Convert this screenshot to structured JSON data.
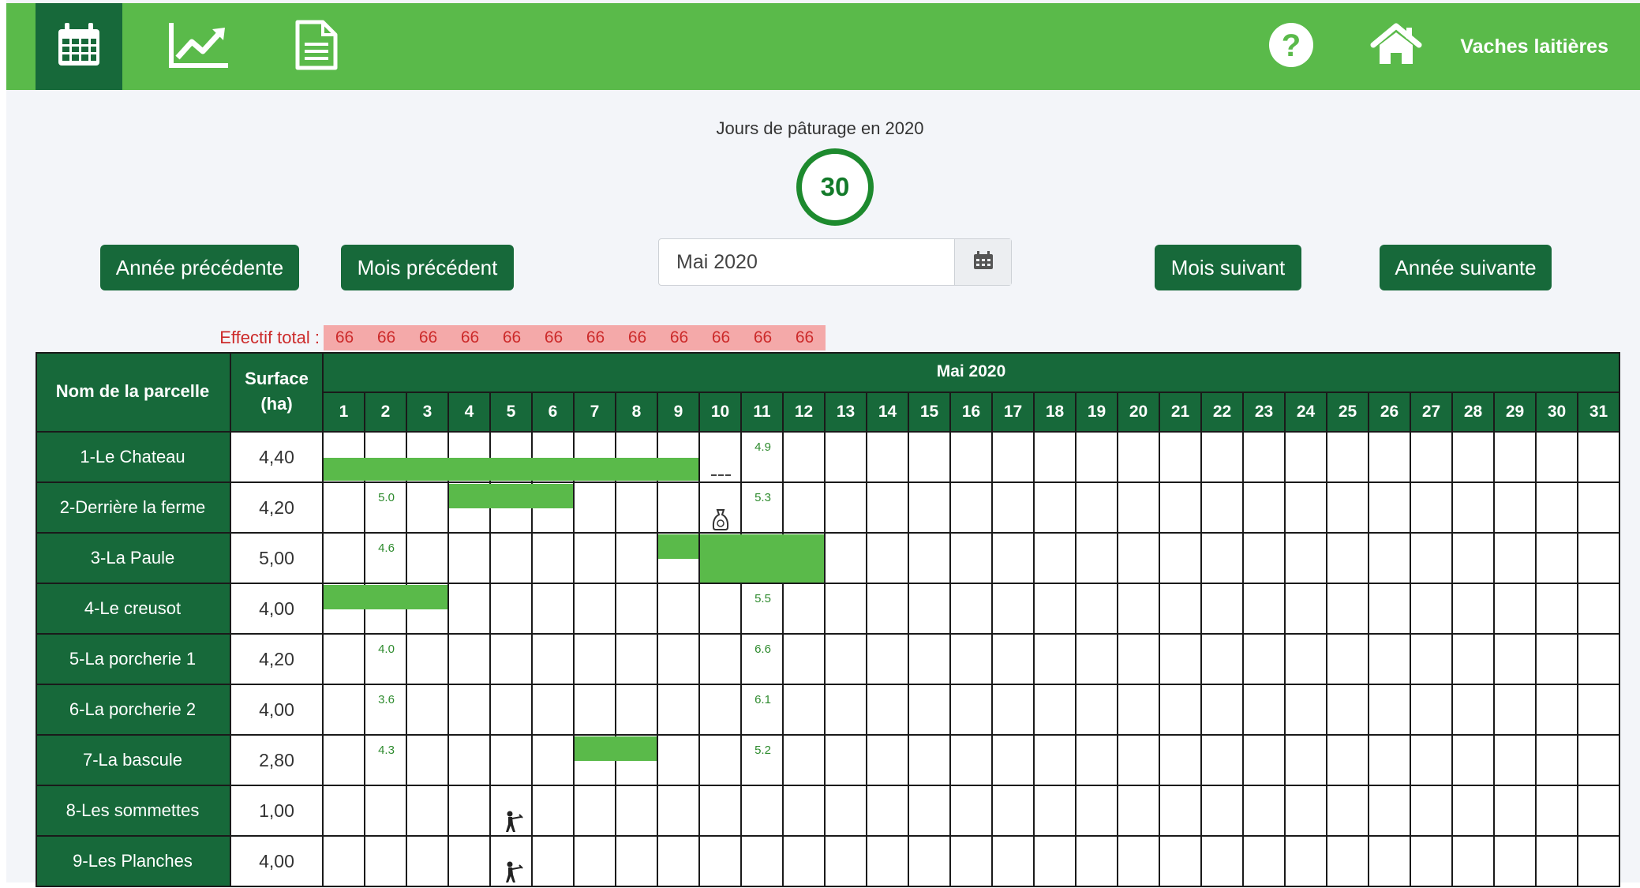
{
  "nav": {
    "tabs": [
      {
        "name": "calendar-icon",
        "active": true
      },
      {
        "name": "chart-icon",
        "active": false
      },
      {
        "name": "document-icon",
        "active": false
      }
    ],
    "help_icon": "question-circle-icon",
    "home_icon": "home-icon",
    "farm_label": "Vaches laitières"
  },
  "colors": {
    "nav_green": "#5aba4a",
    "dark_green": "#17693a",
    "grazing_bar": "#5aba4a",
    "effectif_bg": "#f4a9a9",
    "effectif_text": "#cc2a2a"
  },
  "summary": {
    "title": "Jours de pâturage en 2020",
    "days": "30"
  },
  "controls": {
    "prev_year": "Année précédente",
    "prev_month": "Mois précédent",
    "month_value": "Mai 2020",
    "next_month": "Mois suivant",
    "next_year": "Année suivante"
  },
  "effectif": {
    "label": "Effectif total :",
    "values": [
      "66",
      "66",
      "66",
      "66",
      "66",
      "66",
      "66",
      "66",
      "66",
      "66",
      "66",
      "66"
    ]
  },
  "table": {
    "col_name": "Nom de la parcelle",
    "col_surface": "Surface (ha)",
    "month_title": "Mai 2020",
    "days": [
      "1",
      "2",
      "3",
      "4",
      "5",
      "6",
      "7",
      "8",
      "9",
      "10",
      "11",
      "12",
      "13",
      "14",
      "15",
      "16",
      "17",
      "18",
      "19",
      "20",
      "21",
      "22",
      "23",
      "24",
      "25",
      "26",
      "27",
      "28",
      "29",
      "30",
      "31"
    ],
    "rows": [
      {
        "name": "1-Le Chateau",
        "surface": "4,40",
        "grazing": [
          {
            "from": 1,
            "to": 9,
            "band": "bottom"
          }
        ],
        "notes": [
          {
            "day": 11,
            "text": "4.9"
          }
        ],
        "icons": [
          {
            "day": 10,
            "type": "dash-icon"
          }
        ]
      },
      {
        "name": "2-Derrière la ferme",
        "surface": "4,20",
        "grazing": [
          {
            "from": 4,
            "to": 6,
            "band": "top"
          }
        ],
        "notes": [
          {
            "day": 2,
            "text": "5.0"
          },
          {
            "day": 11,
            "text": "5.3"
          }
        ],
        "icons": [
          {
            "day": 10,
            "type": "fertilizer-bag-icon"
          }
        ]
      },
      {
        "name": "3-La Paule",
        "surface": "5,00",
        "grazing": [
          {
            "from": 9,
            "to": 9,
            "band": "top"
          },
          {
            "from": 10,
            "to": 12,
            "band": "full"
          }
        ],
        "notes": [
          {
            "day": 2,
            "text": "4.6"
          }
        ],
        "icons": []
      },
      {
        "name": "4-Le creusot",
        "surface": "4,00",
        "grazing": [
          {
            "from": 1,
            "to": 3,
            "band": "top"
          }
        ],
        "notes": [
          {
            "day": 11,
            "text": "5.5"
          }
        ],
        "icons": []
      },
      {
        "name": "5-La porcherie 1",
        "surface": "4,20",
        "grazing": [],
        "notes": [
          {
            "day": 2,
            "text": "4.0"
          },
          {
            "day": 11,
            "text": "6.6"
          }
        ],
        "icons": []
      },
      {
        "name": "6-La porcherie 2",
        "surface": "4,00",
        "grazing": [],
        "notes": [
          {
            "day": 2,
            "text": "3.6"
          },
          {
            "day": 11,
            "text": "6.1"
          }
        ],
        "icons": []
      },
      {
        "name": "7-La bascule",
        "surface": "2,80",
        "grazing": [
          {
            "from": 7,
            "to": 8,
            "band": "top"
          }
        ],
        "notes": [
          {
            "day": 2,
            "text": "4.3"
          },
          {
            "day": 11,
            "text": "5.2"
          }
        ],
        "icons": []
      },
      {
        "name": "8-Les sommettes",
        "surface": "1,00",
        "grazing": [],
        "notes": [],
        "icons": [
          {
            "day": 5,
            "type": "mowing-person-icon"
          }
        ]
      },
      {
        "name": "9-Les Planches",
        "surface": "4,00",
        "grazing": [],
        "notes": [],
        "icons": [
          {
            "day": 5,
            "type": "mowing-person-icon"
          }
        ]
      }
    ]
  }
}
